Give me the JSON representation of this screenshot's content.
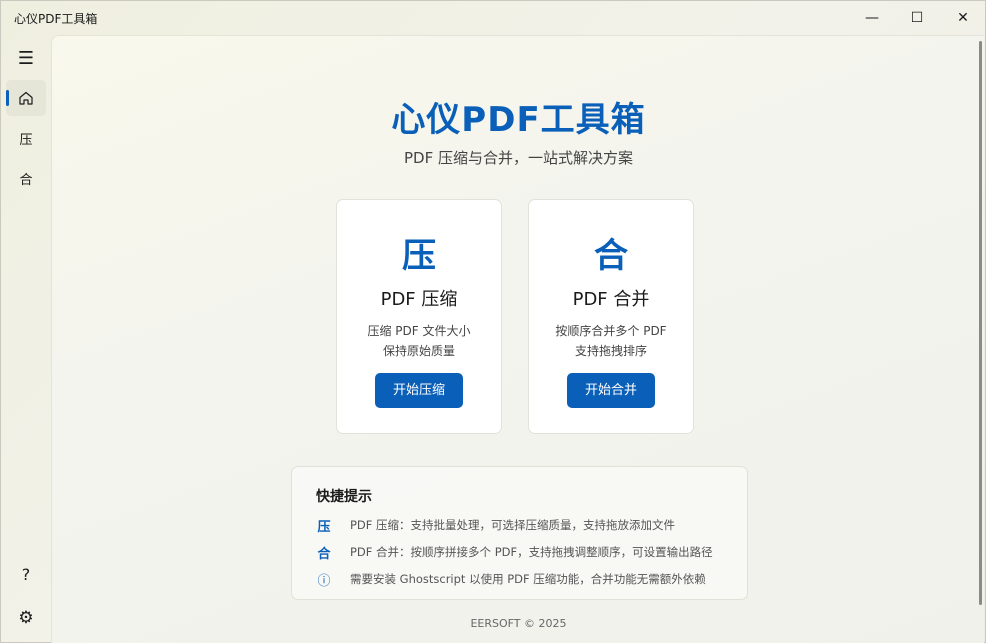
{
  "window": {
    "title": "心仪PDF工具箱",
    "controls": {
      "minimize": "—",
      "maximize": "☐",
      "close": "✕"
    }
  },
  "sidebar": {
    "menu_icon": "☰",
    "items": [
      {
        "icon": "home-icon",
        "glyph": "⌂",
        "active": true
      },
      {
        "label": "压"
      },
      {
        "label": "合"
      }
    ],
    "help_glyph": "?",
    "settings_glyph": "⚙"
  },
  "hero": {
    "title": "心仪PDF工具箱",
    "subtitle": "PDF 压缩与合并，一站式解决方案"
  },
  "cards": [
    {
      "glyph": "压",
      "title": "PDF 压缩",
      "desc_line1": "压缩 PDF 文件大小",
      "desc_line2": "保持原始质量",
      "button": "开始压缩"
    },
    {
      "glyph": "合",
      "title": "PDF 合并",
      "desc_line1": "按顺序合并多个 PDF",
      "desc_line2": "支持拖拽排序",
      "button": "开始合并"
    }
  ],
  "tips": {
    "title": "快捷提示",
    "items": [
      {
        "icon": "压",
        "text": "PDF 压缩：支持批量处理，可选择压缩质量，支持拖放添加文件"
      },
      {
        "icon": "合",
        "text": "PDF 合并：按顺序拼接多个 PDF，支持拖拽调整顺序，可设置输出路径"
      },
      {
        "icon": "ⓘ",
        "text": "需要安装 Ghostscript 以使用 PDF 压缩功能，合并功能无需额外依赖"
      }
    ]
  },
  "footer": "EERSOFT © 2025",
  "colors": {
    "accent": "#0a5fb8",
    "card_bg": "#ffffff"
  }
}
